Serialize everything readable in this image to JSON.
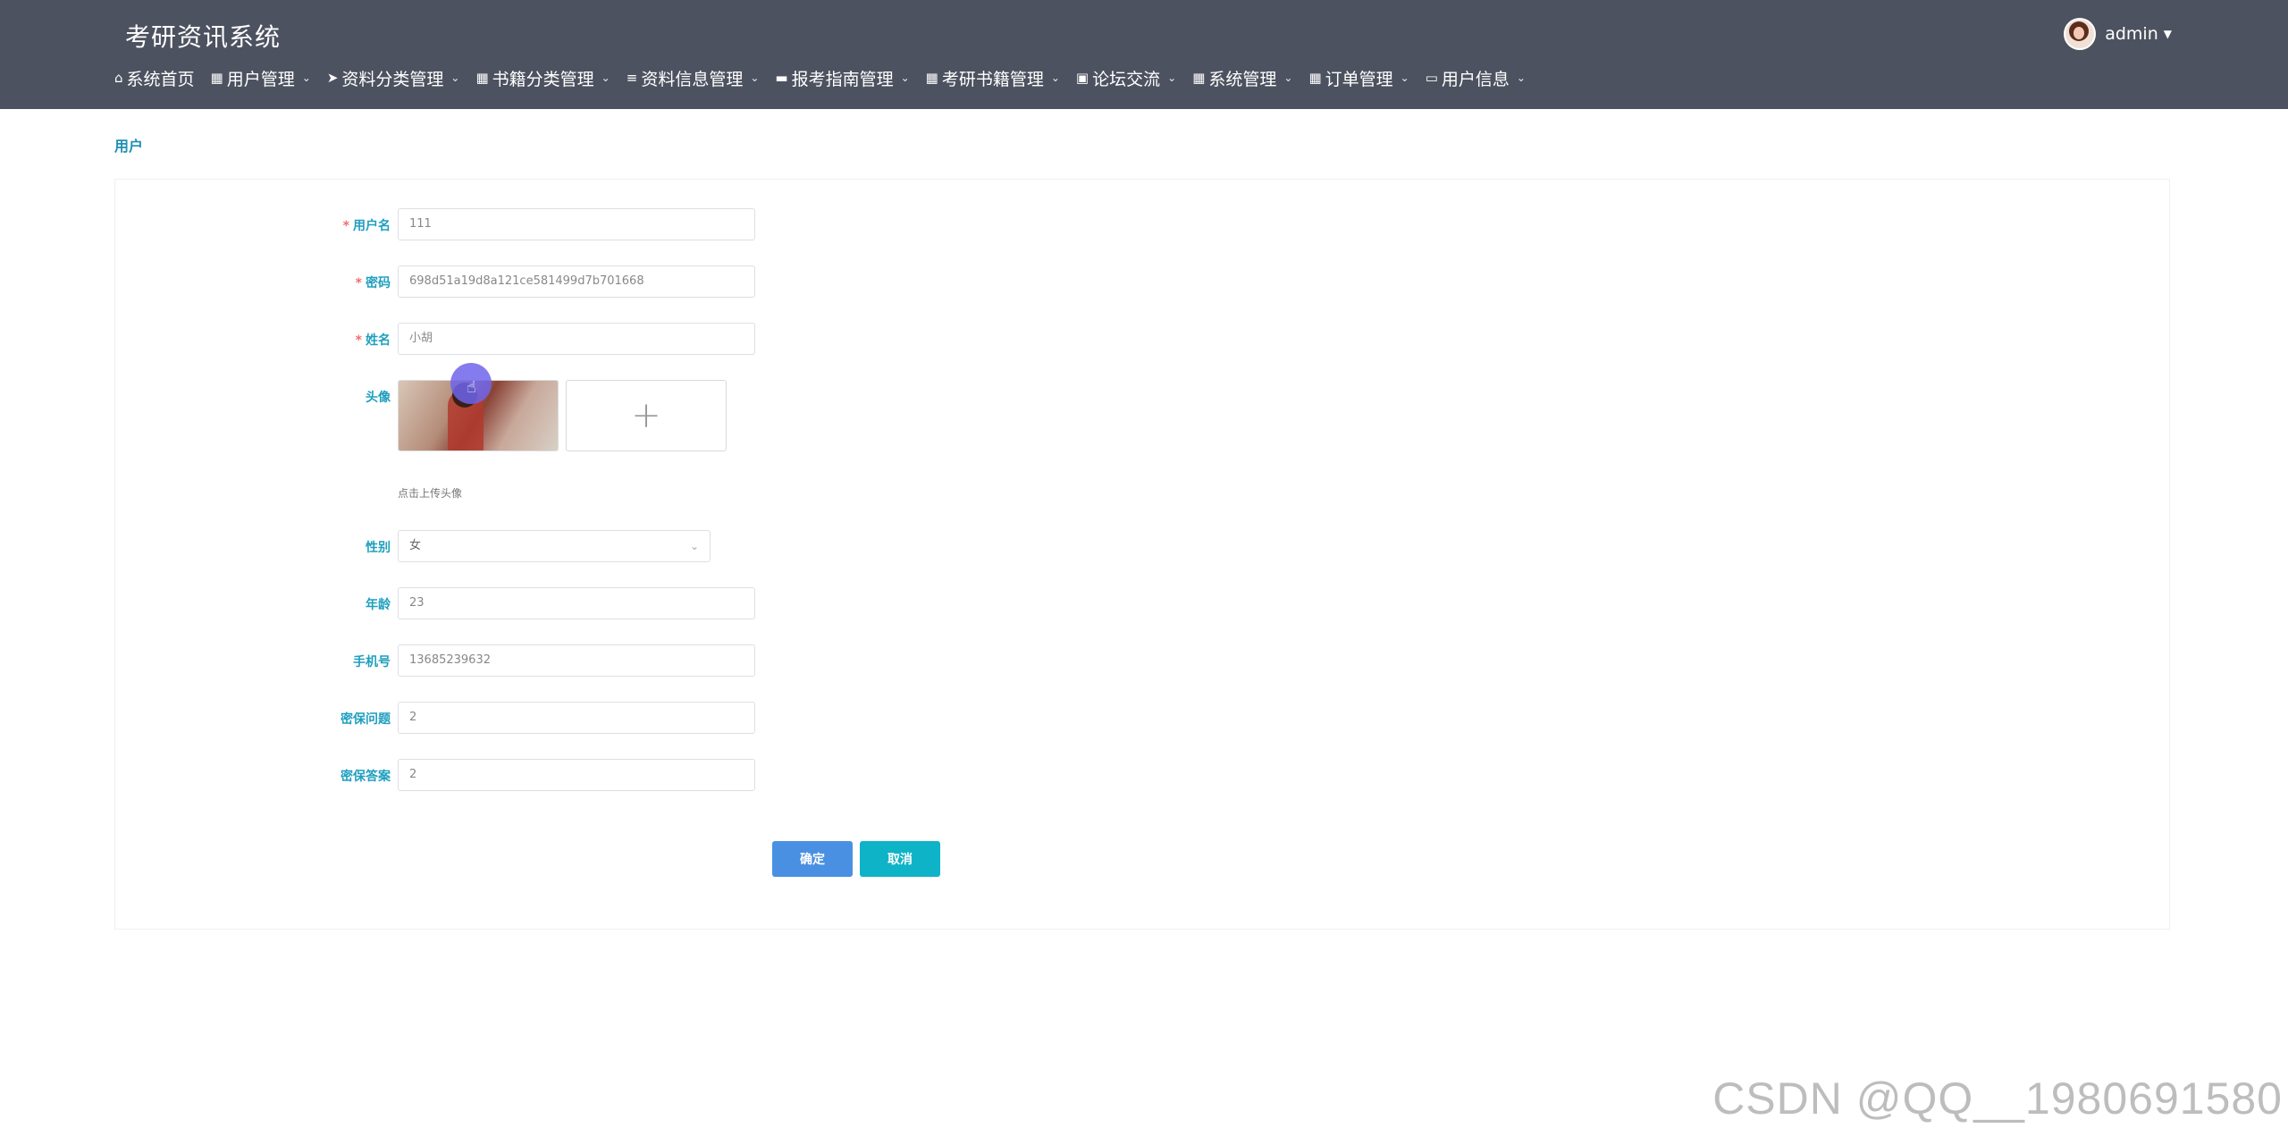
{
  "app": {
    "title": "考研资讯系统"
  },
  "user": {
    "name": "admin"
  },
  "nav": [
    {
      "label": "系统首页",
      "icon": "home-icon",
      "glyph": "⌂",
      "dropdown": false
    },
    {
      "label": "用户管理",
      "icon": "grid-icon",
      "glyph": "▦",
      "dropdown": true
    },
    {
      "label": "资料分类管理",
      "icon": "paper-plane-icon",
      "glyph": "➤",
      "dropdown": true
    },
    {
      "label": "书籍分类管理",
      "icon": "grid-icon",
      "glyph": "▦",
      "dropdown": true
    },
    {
      "label": "资料信息管理",
      "icon": "sliders-icon",
      "glyph": "≡",
      "dropdown": true
    },
    {
      "label": "报考指南管理",
      "icon": "book-icon",
      "glyph": "▬",
      "dropdown": true
    },
    {
      "label": "考研书籍管理",
      "icon": "grid-icon",
      "glyph": "▦",
      "dropdown": true
    },
    {
      "label": "论坛交流",
      "icon": "chat-icon",
      "glyph": "▣",
      "dropdown": true
    },
    {
      "label": "系统管理",
      "icon": "grid-icon",
      "glyph": "▦",
      "dropdown": true
    },
    {
      "label": "订单管理",
      "icon": "grid-icon",
      "glyph": "▦",
      "dropdown": true
    },
    {
      "label": "用户信息",
      "icon": "card-icon",
      "glyph": "▭",
      "dropdown": true
    }
  ],
  "breadcrumb": "用户",
  "form": {
    "username": {
      "label": "用户名",
      "value": "111",
      "required": true
    },
    "password": {
      "label": "密码",
      "value": "698d51a19d8a121ce581499d7b701668",
      "required": true
    },
    "name": {
      "label": "姓名",
      "value": "小胡",
      "required": true
    },
    "avatar": {
      "label": "头像",
      "hint": "点击上传头像",
      "add_symbol": "+"
    },
    "gender": {
      "label": "性别",
      "value": "女"
    },
    "age": {
      "label": "年龄",
      "value": "23"
    },
    "phone": {
      "label": "手机号",
      "value": "13685239632"
    },
    "security_question": {
      "label": "密保问题",
      "value": "2"
    },
    "security_answer": {
      "label": "密保答案",
      "value": "2"
    },
    "ok_label": "确定",
    "cancel_label": "取消"
  },
  "watermark": "CSDN @QQ__1980691580",
  "colors": {
    "topbar": "#4d5260",
    "label": "#1f9fbf",
    "required": "#f56c6c",
    "ok": "#4a90e2",
    "cancel": "#0fb3c7",
    "cursor": "#6e64eb"
  }
}
